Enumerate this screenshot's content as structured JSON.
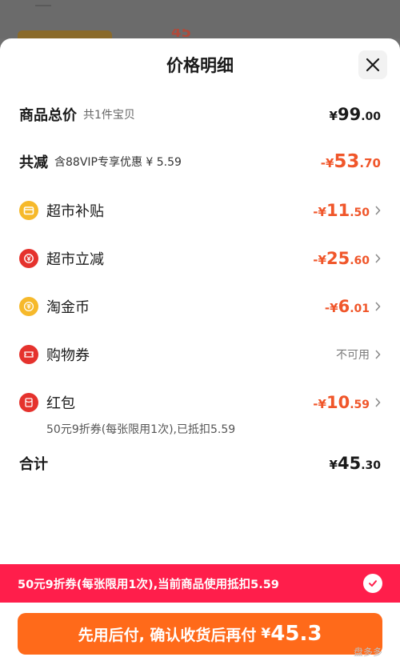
{
  "header": {
    "title": "价格明细"
  },
  "total_price": {
    "label": "商品总价",
    "sub": "共1件宝贝",
    "currency": "¥",
    "int": "99",
    "dec": ".00"
  },
  "discount": {
    "label": "共减",
    "sub": "含88VIP专享优惠 ¥ 5.59",
    "sign": "-¥",
    "int": "53",
    "dec": ".70"
  },
  "items": [
    {
      "name": "超市补贴",
      "icon": "wallet-icon",
      "sign": "-¥",
      "int": "11",
      "dec": ".50"
    },
    {
      "name": "超市立减",
      "icon": "discount-icon",
      "sign": "-¥",
      "int": "25",
      "dec": ".60"
    },
    {
      "name": "淘金币",
      "icon": "coin-icon",
      "sign": "-¥",
      "int": "6",
      "dec": ".01"
    },
    {
      "name": "购物券",
      "icon": "ticket-icon",
      "value": "不可用"
    },
    {
      "name": "红包",
      "icon": "red-packet-icon",
      "sign": "-¥",
      "int": "10",
      "dec": ".59"
    }
  ],
  "red_packet_note": "50元9折券(每张限用1次),已抵扣5.59",
  "sum": {
    "label": "合计",
    "currency": "¥",
    "int": "45",
    "dec": ".30"
  },
  "coupon_bar": {
    "text": "50元9折券(每张限用1次),当前商品使用抵扣5.59"
  },
  "pay_button": {
    "text": "先用后付, 确认收货后再付",
    "currency": "¥",
    "amount": "45.3"
  },
  "watermark": "盘多多",
  "colors": {
    "accent_orange": "#f0562a",
    "button_orange": "#ff6a1a",
    "coupon_red": "#ff1e4b",
    "icon_yellow": "#f6b92b",
    "icon_red": "#e5322d"
  }
}
